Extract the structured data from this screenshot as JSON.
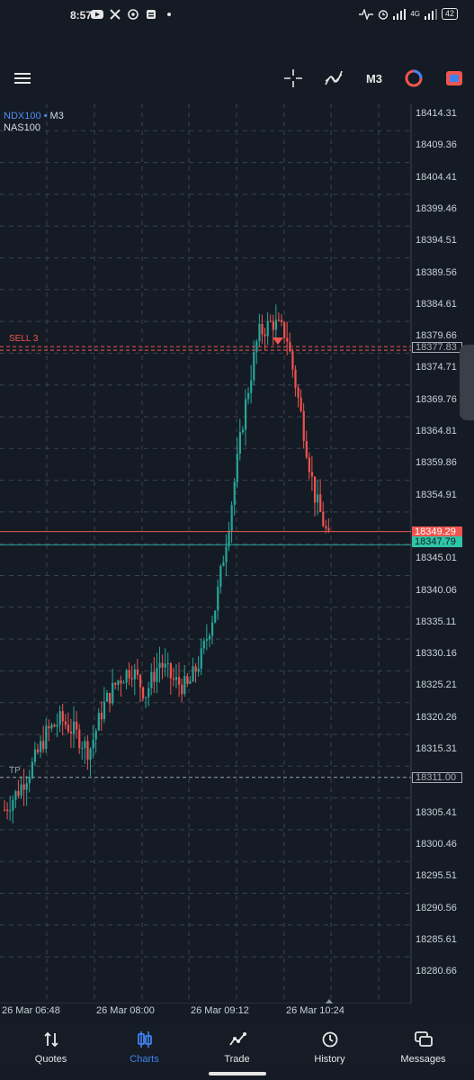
{
  "status_bar": {
    "time": "8:57",
    "network": "4G",
    "battery": "42",
    "icons": [
      "youtube-icon",
      "x-icon",
      "threads-icon",
      "app-icon",
      "dot-icon"
    ]
  },
  "toolbar": {
    "timeframe": "M3",
    "icons": [
      "menu-icon",
      "crosshair-icon",
      "indicators-icon",
      "objects-icon",
      "trade-icon"
    ]
  },
  "chart": {
    "symbol": "NDX100",
    "separator": " • ",
    "timeframe": "M3",
    "description": "NAS100",
    "price_labels": [
      "18414.31",
      "18409.36",
      "18404.41",
      "18399.46",
      "18394.51",
      "18389.56",
      "18384.61",
      "18379.66",
      "18374.71",
      "18369.76",
      "18364.81",
      "18359.86",
      "18354.91",
      "18345.01",
      "18340.06",
      "18335.11",
      "18330.16",
      "18325.21",
      "18320.26",
      "18315.31",
      "18305.41",
      "18300.46",
      "18295.51",
      "18290.56",
      "18285.61",
      "18280.66"
    ],
    "sell_order": {
      "label": "SELL 3",
      "price": "18377.83"
    },
    "tp": {
      "label": "TP",
      "price": "18311.00"
    },
    "bid": "18349.29",
    "ask": "18347.79",
    "time_labels": [
      "26 Mar 06:48",
      "26 Mar 08:00",
      "26 Mar 09:12",
      "26 Mar 10:24"
    ],
    "colors": {
      "bull": "#26a69a",
      "bear": "#ef5350",
      "grid": "#3a4350",
      "background": "#151b24"
    }
  },
  "chart_data": {
    "type": "candlestick",
    "symbol": "NDX100",
    "timeframe": "M3",
    "x": [
      "26 Mar 06:48",
      "26 Mar 08:00",
      "26 Mar 09:12",
      "26 Mar 10:24"
    ],
    "ylim": [
      18280.66,
      18414.31
    ],
    "close_path": [
      18306,
      18309,
      18313,
      18318,
      18320,
      18318,
      18315,
      18322,
      18326,
      18328,
      18324,
      18329,
      18326,
      18325,
      18330,
      18338,
      18352,
      18368,
      18380,
      18382,
      18380,
      18368,
      18355,
      18348
    ],
    "horizontal_lines": [
      {
        "name": "SELL 3",
        "value": 18377.83
      },
      {
        "name": "TP",
        "value": 18311.0
      },
      {
        "name": "bid",
        "value": 18349.29
      },
      {
        "name": "ask",
        "value": 18347.79
      }
    ]
  },
  "nav": {
    "items": [
      {
        "label": "Quotes",
        "icon": "quotes-icon"
      },
      {
        "label": "Charts",
        "icon": "charts-icon",
        "active": true
      },
      {
        "label": "Trade",
        "icon": "trade-icon"
      },
      {
        "label": "History",
        "icon": "history-icon"
      },
      {
        "label": "Messages",
        "icon": "messages-icon"
      }
    ]
  }
}
